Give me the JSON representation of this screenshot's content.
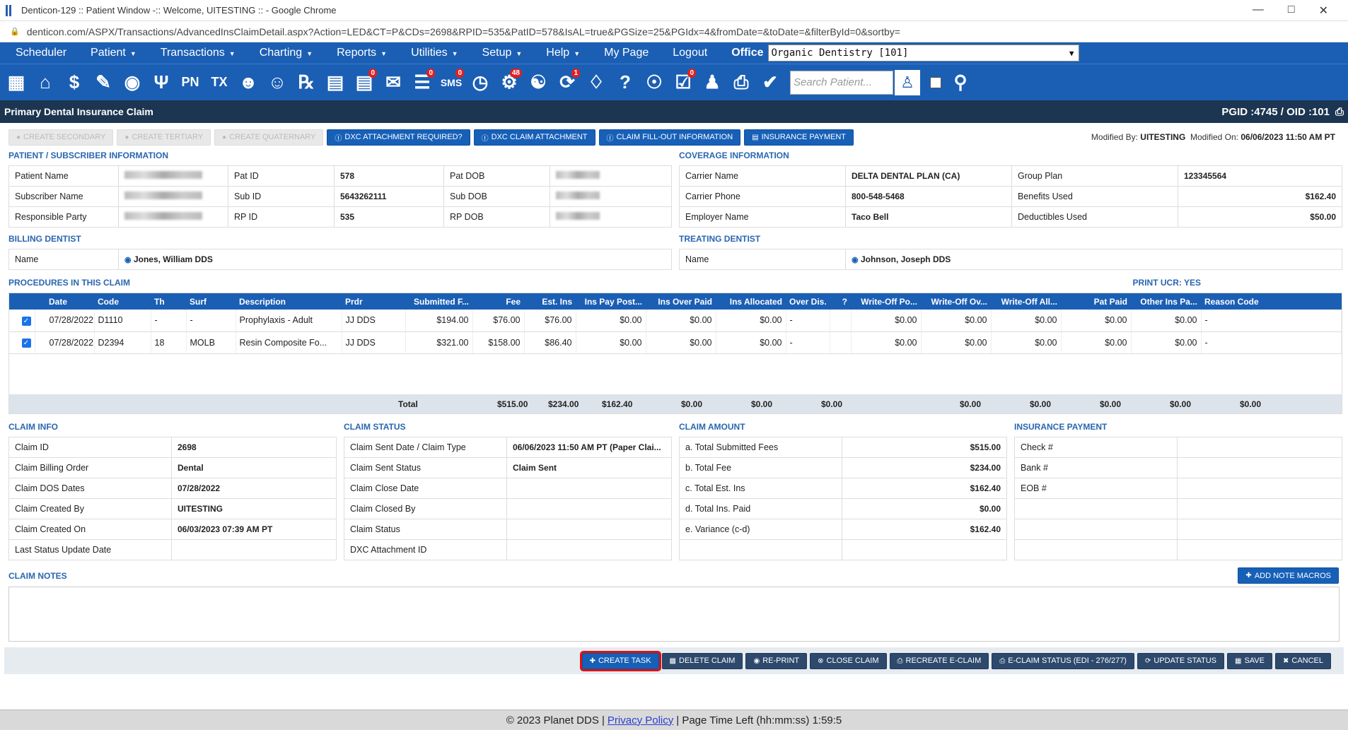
{
  "window": {
    "title": "Denticon-129 :: Patient Window -:: Welcome, UITESTING :: - Google Chrome",
    "url": "denticon.com/ASPX/Transactions/AdvancedInsClaimDetail.aspx?Action=LED&CT=P&CDs=2698&RPID=535&PatID=578&IsAL=true&PGSize=25&PGIdx=4&fromDate=&toDate=&filterById=0&sortby="
  },
  "menu": {
    "items": [
      "Scheduler",
      "Patient",
      "Transactions",
      "Charting",
      "Reports",
      "Utilities",
      "Setup",
      "Help",
      "My Page",
      "Logout"
    ],
    "office_label": "Office",
    "office_value": "Organic Dentistry [101]"
  },
  "toolbar": {
    "search_placeholder": "Search Patient...",
    "badges": {
      "claims": "0",
      "sms": "0",
      "alerts": "48",
      "reminders": "1",
      "eob": "0"
    },
    "pn": "PN",
    "tx": "TX"
  },
  "page": {
    "title": "Primary Dental Insurance Claim",
    "ids": "PGID :4745  /  OID :101"
  },
  "actions": {
    "create_secondary": "CREATE SECONDARY",
    "create_tertiary": "CREATE TERTIARY",
    "create_quaternary": "CREATE QUATERNARY",
    "dxc_required": "DXC ATTACHMENT REQUIRED?",
    "dxc_attachment": "DXC CLAIM ATTACHMENT",
    "fillout": "CLAIM FILL-OUT INFORMATION",
    "ins_payment": "INSURANCE PAYMENT"
  },
  "modified": {
    "by_label": "Modified By:",
    "by": "UITESTING",
    "on_label": "Modified On:",
    "on": "06/06/2023 11:50 AM PT"
  },
  "patient": {
    "heading": "PATIENT / SUBSCRIBER INFORMATION",
    "rows": [
      {
        "l1": "Patient Name",
        "l2": "Pat ID",
        "v2": "578",
        "l3": "Pat DOB"
      },
      {
        "l1": "Subscriber Name",
        "l2": "Sub ID",
        "v2": "5643262111",
        "l3": "Sub DOB"
      },
      {
        "l1": "Responsible Party",
        "l2": "RP ID",
        "v2": "535",
        "l3": "RP DOB"
      }
    ]
  },
  "coverage": {
    "heading": "COVERAGE INFORMATION",
    "rows": [
      {
        "l1": "Carrier Name",
        "v1": "DELTA DENTAL PLAN (CA)",
        "l2": "Group Plan",
        "v2": "123345564"
      },
      {
        "l1": "Carrier Phone",
        "v1": "800-548-5468",
        "l2": "Benefits Used",
        "v2": "$162.40"
      },
      {
        "l1": "Employer Name",
        "v1": "Taco Bell",
        "l2": "Deductibles Used",
        "v2": "$50.00"
      }
    ]
  },
  "billing": {
    "heading": "BILLING DENTIST",
    "label": "Name",
    "value": "Jones, William DDS"
  },
  "treating": {
    "heading": "TREATING DENTIST",
    "label": "Name",
    "value": "Johnson, Joseph DDS"
  },
  "procedures": {
    "heading": "PROCEDURES IN THIS CLAIM",
    "print_ucr": "PRINT UCR: YES",
    "columns": [
      "Date",
      "Code",
      "Th",
      "Surf",
      "Description",
      "Prdr",
      "Submitted F...",
      "Fee",
      "Est. Ins",
      "Ins Pay Post...",
      "Ins Over Paid",
      "Ins Allocated",
      "Over Dis.",
      "?",
      "Write-Off Po...",
      "Write-Off Ov...",
      "Write-Off All...",
      "Pat Paid",
      "Other Ins Pa...",
      "Reason Code"
    ],
    "rows": [
      [
        "07/28/2022",
        "D1110",
        "-",
        "-",
        "Prophylaxis - Adult",
        "JJ DDS",
        "$194.00",
        "$76.00",
        "$76.00",
        "$0.00",
        "$0.00",
        "$0.00",
        "-",
        "",
        "$0.00",
        "$0.00",
        "$0.00",
        "$0.00",
        "$0.00",
        "-"
      ],
      [
        "07/28/2022",
        "D2394",
        "18",
        "MOLB",
        "Resin Composite Fo...",
        "JJ DDS",
        "$321.00",
        "$158.00",
        "$86.40",
        "$0.00",
        "$0.00",
        "$0.00",
        "-",
        "",
        "$0.00",
        "$0.00",
        "$0.00",
        "$0.00",
        "$0.00",
        "-"
      ]
    ],
    "total_label": "Total",
    "totals": [
      "$515.00",
      "$234.00",
      "$162.40",
      "$0.00",
      "$0.00",
      "$0.00",
      "$0.00",
      "$0.00",
      "$0.00",
      "$0.00",
      "$0.00"
    ]
  },
  "claim_info": {
    "heading": "CLAIM INFO",
    "rows": [
      {
        "l": "Claim ID",
        "v": "2698"
      },
      {
        "l": "Claim Billing Order",
        "v": "Dental"
      },
      {
        "l": "Claim DOS Dates",
        "v": "07/28/2022"
      },
      {
        "l": "Claim Created By",
        "v": "UITESTING"
      },
      {
        "l": "Claim Created On",
        "v": "06/03/2023 07:39 AM PT"
      },
      {
        "l": "Last Status Update Date",
        "v": ""
      }
    ]
  },
  "claim_status": {
    "heading": "CLAIM STATUS",
    "rows": [
      {
        "l": "Claim Sent Date / Claim Type",
        "v": "06/06/2023 11:50 AM PT (Paper Clai..."
      },
      {
        "l": "Claim Sent Status",
        "v": "Claim Sent"
      },
      {
        "l": "Claim Close Date",
        "v": ""
      },
      {
        "l": "Claim Closed By",
        "v": ""
      },
      {
        "l": "Claim Status",
        "v": ""
      },
      {
        "l": "DXC Attachment ID",
        "v": ""
      }
    ]
  },
  "claim_amount": {
    "heading": "CLAIM AMOUNT",
    "rows": [
      {
        "l": "a. Total Submitted Fees",
        "v": "$515.00"
      },
      {
        "l": "b. Total Fee",
        "v": "$234.00"
      },
      {
        "l": "c. Total Est. Ins",
        "v": "$162.40"
      },
      {
        "l": "d. Total Ins. Paid",
        "v": "$0.00"
      },
      {
        "l": "e. Variance (c-d)",
        "v": "$162.40"
      },
      {
        "l": "",
        "v": ""
      }
    ]
  },
  "insurance_payment": {
    "heading": "INSURANCE PAYMENT",
    "rows": [
      {
        "l": "Check #"
      },
      {
        "l": "Bank #"
      },
      {
        "l": "EOB #"
      },
      {
        "l": ""
      },
      {
        "l": ""
      },
      {
        "l": ""
      }
    ]
  },
  "notes": {
    "heading": "CLAIM NOTES",
    "add_macros": "ADD NOTE MACROS"
  },
  "footer_buttons": {
    "create_task": "CREATE TASK",
    "delete": "DELETE CLAIM",
    "reprint": "RE-PRINT",
    "close": "CLOSE CLAIM",
    "recreate": "RECREATE E-CLAIM",
    "estatus": "E-CLAIM STATUS (EDI - 276/277)",
    "update": "UPDATE STATUS",
    "save": "SAVE",
    "cancel": "CANCEL"
  },
  "copyright": {
    "text": "© 2023 Planet DDS |",
    "privacy": "Privacy Policy",
    "time_label": "| Page Time Left (hh:mm:ss)",
    "time": "1:59:5"
  }
}
